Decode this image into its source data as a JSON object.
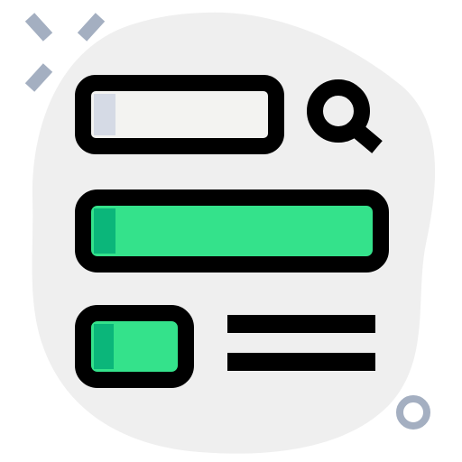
{
  "illustration": {
    "subject": "search-form-icon",
    "colors": {
      "outline": "#000000",
      "blob": "#efefef",
      "field_fill": "#f3f3f1",
      "field_shade": "#d5dae5",
      "bar_fill": "#34e28b",
      "bar_shade": "#0bb67a",
      "decoration": "#a4afc1",
      "background": "#ffffff"
    },
    "icons": [
      "search-icon",
      "sparkle-decoration",
      "ring-decoration"
    ]
  }
}
